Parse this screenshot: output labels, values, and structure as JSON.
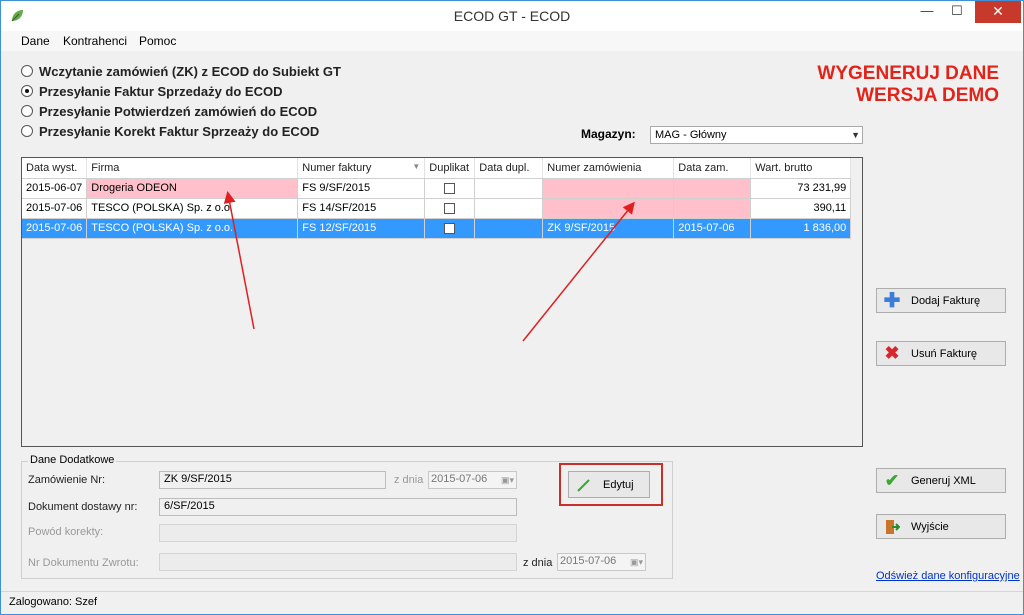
{
  "window": {
    "title": "ECOD GT -  ECOD"
  },
  "titlebar": {
    "minimize": "—",
    "maximize": "☐",
    "close": "✕"
  },
  "menu": [
    "Dane",
    "Kontrahenci",
    "Pomoc"
  ],
  "options": [
    {
      "label": "Wczytanie zamówień (ZK) z ECOD do Subiekt GT",
      "selected": false
    },
    {
      "label": "Przesyłanie Faktur Sprzedaży do ECOD",
      "selected": true
    },
    {
      "label": "Przesyłanie Potwierdzeń zamówień do ECOD",
      "selected": false
    },
    {
      "label": "Przesyłanie Korekt Faktur Sprzeaży do ECOD",
      "selected": false
    }
  ],
  "demo": {
    "line1": "WYGENERUJ DANE",
    "line2": "WERSJA DEMO"
  },
  "magazyn": {
    "label": "Magazyn:",
    "value": "MAG - Główny"
  },
  "table": {
    "headers": [
      "Data wyst.",
      "Firma",
      "Numer faktury",
      "Duplikat",
      "Data dupl.",
      "Numer zamówienia",
      "Data zam.",
      "Wart. brutto"
    ],
    "rows": [
      {
        "date": "2015-06-07",
        "firma": "Drogeria ODEON",
        "numer": "FS 9/SF/2015",
        "duplikat": false,
        "data_dupl": "",
        "zam": "",
        "data_zam": "",
        "brutto": "73 231,99"
      },
      {
        "date": "2015-07-06",
        "firma": "TESCO (POLSKA) Sp. z o.o.",
        "numer": "FS 14/SF/2015",
        "duplikat": false,
        "data_dupl": "",
        "zam": "",
        "data_zam": "",
        "brutto": "390,11"
      },
      {
        "date": "2015-07-06",
        "firma": "TESCO (POLSKA) Sp. z o.o.",
        "numer": "FS 12/SF/2015",
        "duplikat": false,
        "data_dupl": "",
        "zam": "ZK 9/SF/2015",
        "data_zam": "2015-07-06",
        "brutto": "1 836,00"
      }
    ]
  },
  "buttons": {
    "add": "Dodaj Fakturę",
    "remove": "Usuń Fakturę",
    "generate": "Generuj XML",
    "exit": "Wyjście",
    "edit": "Edytuj"
  },
  "details": {
    "legend": "Dane Dodatkowe",
    "order_label": "Zamówienie Nr:",
    "order_value": "ZK 9/SF/2015",
    "z_dnia": "z dnia",
    "order_date": "2015-07-06",
    "delivery_label": "Dokument dostawy nr:",
    "delivery_value": "6/SF/2015",
    "reason_label": "Powód korekty:",
    "return_label": "Nr Dokumentu Zwrotu:",
    "return_z_dnia": "z dnia",
    "return_date": "2015-07-06"
  },
  "link": "Odśwież dane konfiguracyjne",
  "status": "Zalogowano: Szef",
  "colors": {
    "accent_red": "#e2231a",
    "selection": "#3399ff",
    "highlight_pink": "#ffc0cb"
  }
}
